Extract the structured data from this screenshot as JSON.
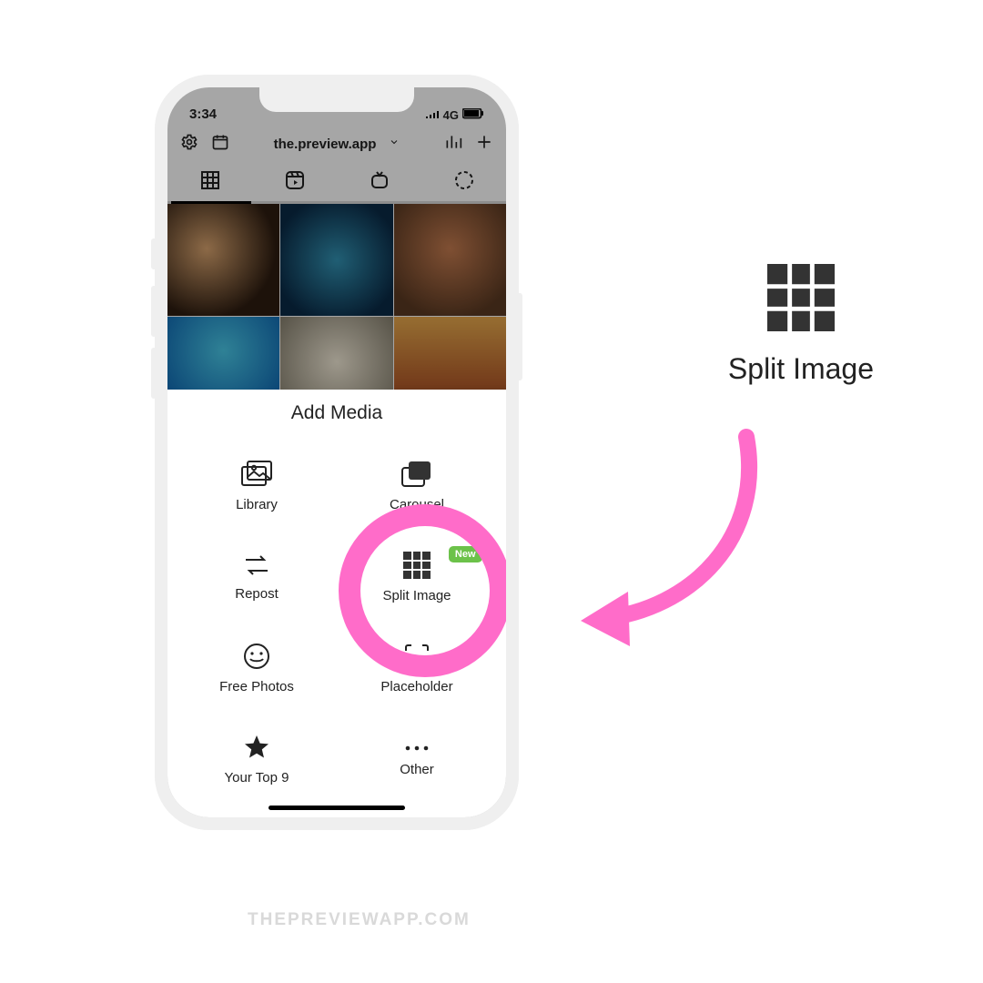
{
  "status": {
    "time": "3:34",
    "network_label": "4G"
  },
  "header": {
    "account": "the.preview.app"
  },
  "sheet": {
    "title": "Add Media",
    "items": {
      "library": "Library",
      "carousel": "Carousel",
      "repost": "Repost",
      "split_image": "Split Image",
      "free_photos": "Free Photos",
      "placeholder": "Placeholder",
      "top9": "Your Top 9",
      "other": "Other"
    },
    "badge_new": "New"
  },
  "callout": {
    "label": "Split Image"
  },
  "watermark": "THEPREVIEWAPP.COM",
  "colors": {
    "accent_pink": "#ff6cc9",
    "badge_green": "#6cc24a"
  }
}
